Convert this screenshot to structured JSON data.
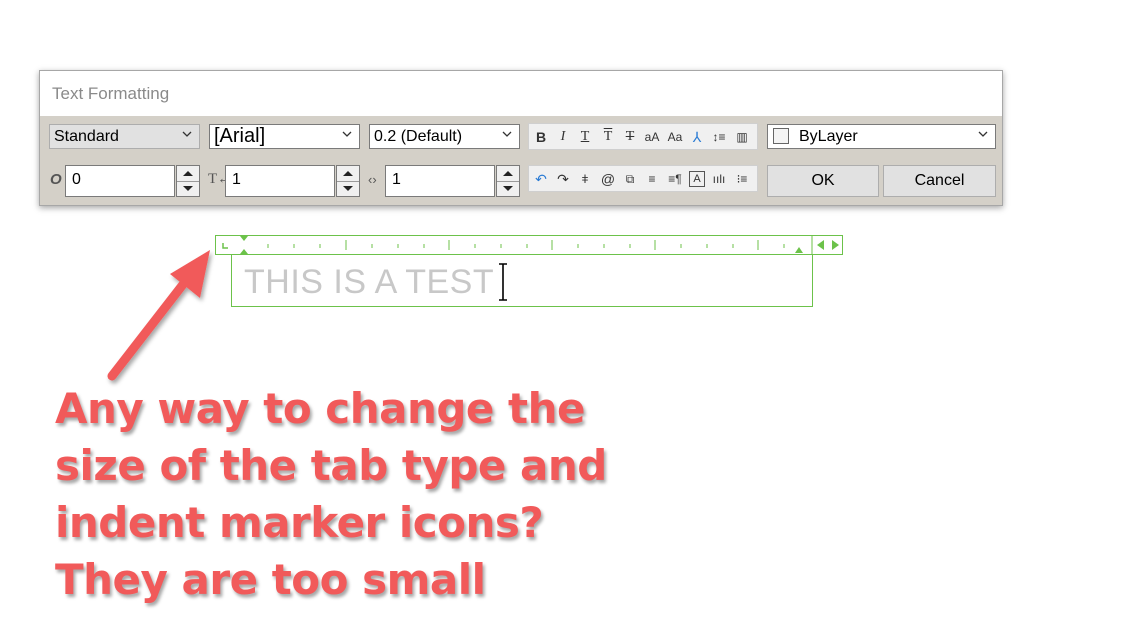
{
  "dialog": {
    "title": "Text Formatting",
    "style_value": "Standard",
    "font_value": "[Arial]",
    "height_value": "0.2 (Default)",
    "color_value": "ByLayer",
    "oblique_value": "0",
    "tracking_value": "1",
    "width_factor_value": "1",
    "ok_label": "OK",
    "cancel_label": "Cancel",
    "tools_row1": [
      "bold-icon",
      "italic-icon",
      "underline-icon",
      "overline-icon",
      "strikethrough-icon",
      "uppercase-icon",
      "lowercase-icon",
      "stack-icon",
      "line-spacing-icon",
      "columns-icon"
    ],
    "tools_row2": [
      "undo-icon",
      "redo-icon",
      "insert-field-icon",
      "symbol-icon",
      "paragraph-icon",
      "align-icon",
      "paragraph-mark-icon",
      "background-mask-icon",
      "ruler-icon",
      "numbering-icon"
    ]
  },
  "editor": {
    "text": "THIS IS A TEST"
  },
  "annotation": {
    "text": "Any way to change the\nsize of the tab type and\nindent marker icons?\nThey are too small",
    "color": "#f15a5a"
  },
  "colors": {
    "ruler_green": "#6cc24a",
    "dialog_bg": "#d4d0c8"
  }
}
